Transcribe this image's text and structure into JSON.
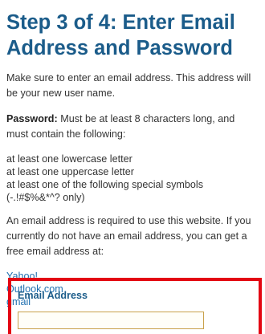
{
  "step": {
    "title": "Step 3 of 4: Enter Email Address and Password",
    "intro": "Make sure to enter an email address. This address will be your new user name.",
    "password_label": "Password:",
    "password_text": " Must be at least 8 characters long, and must contain the following:",
    "rules": [
      "at least one lowercase letter",
      "at least one uppercase letter",
      "at least one of the following special symbols (-.!#$%&*^? only)"
    ],
    "email_note": "An email address is required to use this website. If you currently do not have an email address, you can get a free email address at:",
    "providers": [
      "Yahoo!",
      "Outlook.com",
      "gmail"
    ]
  },
  "form": {
    "email_label": "Email Address",
    "email_value": "",
    "email_placeholder": ""
  },
  "colors": {
    "heading": "#1b5c8a",
    "link": "#1f6fb0",
    "highlight_border": "#e30613"
  }
}
